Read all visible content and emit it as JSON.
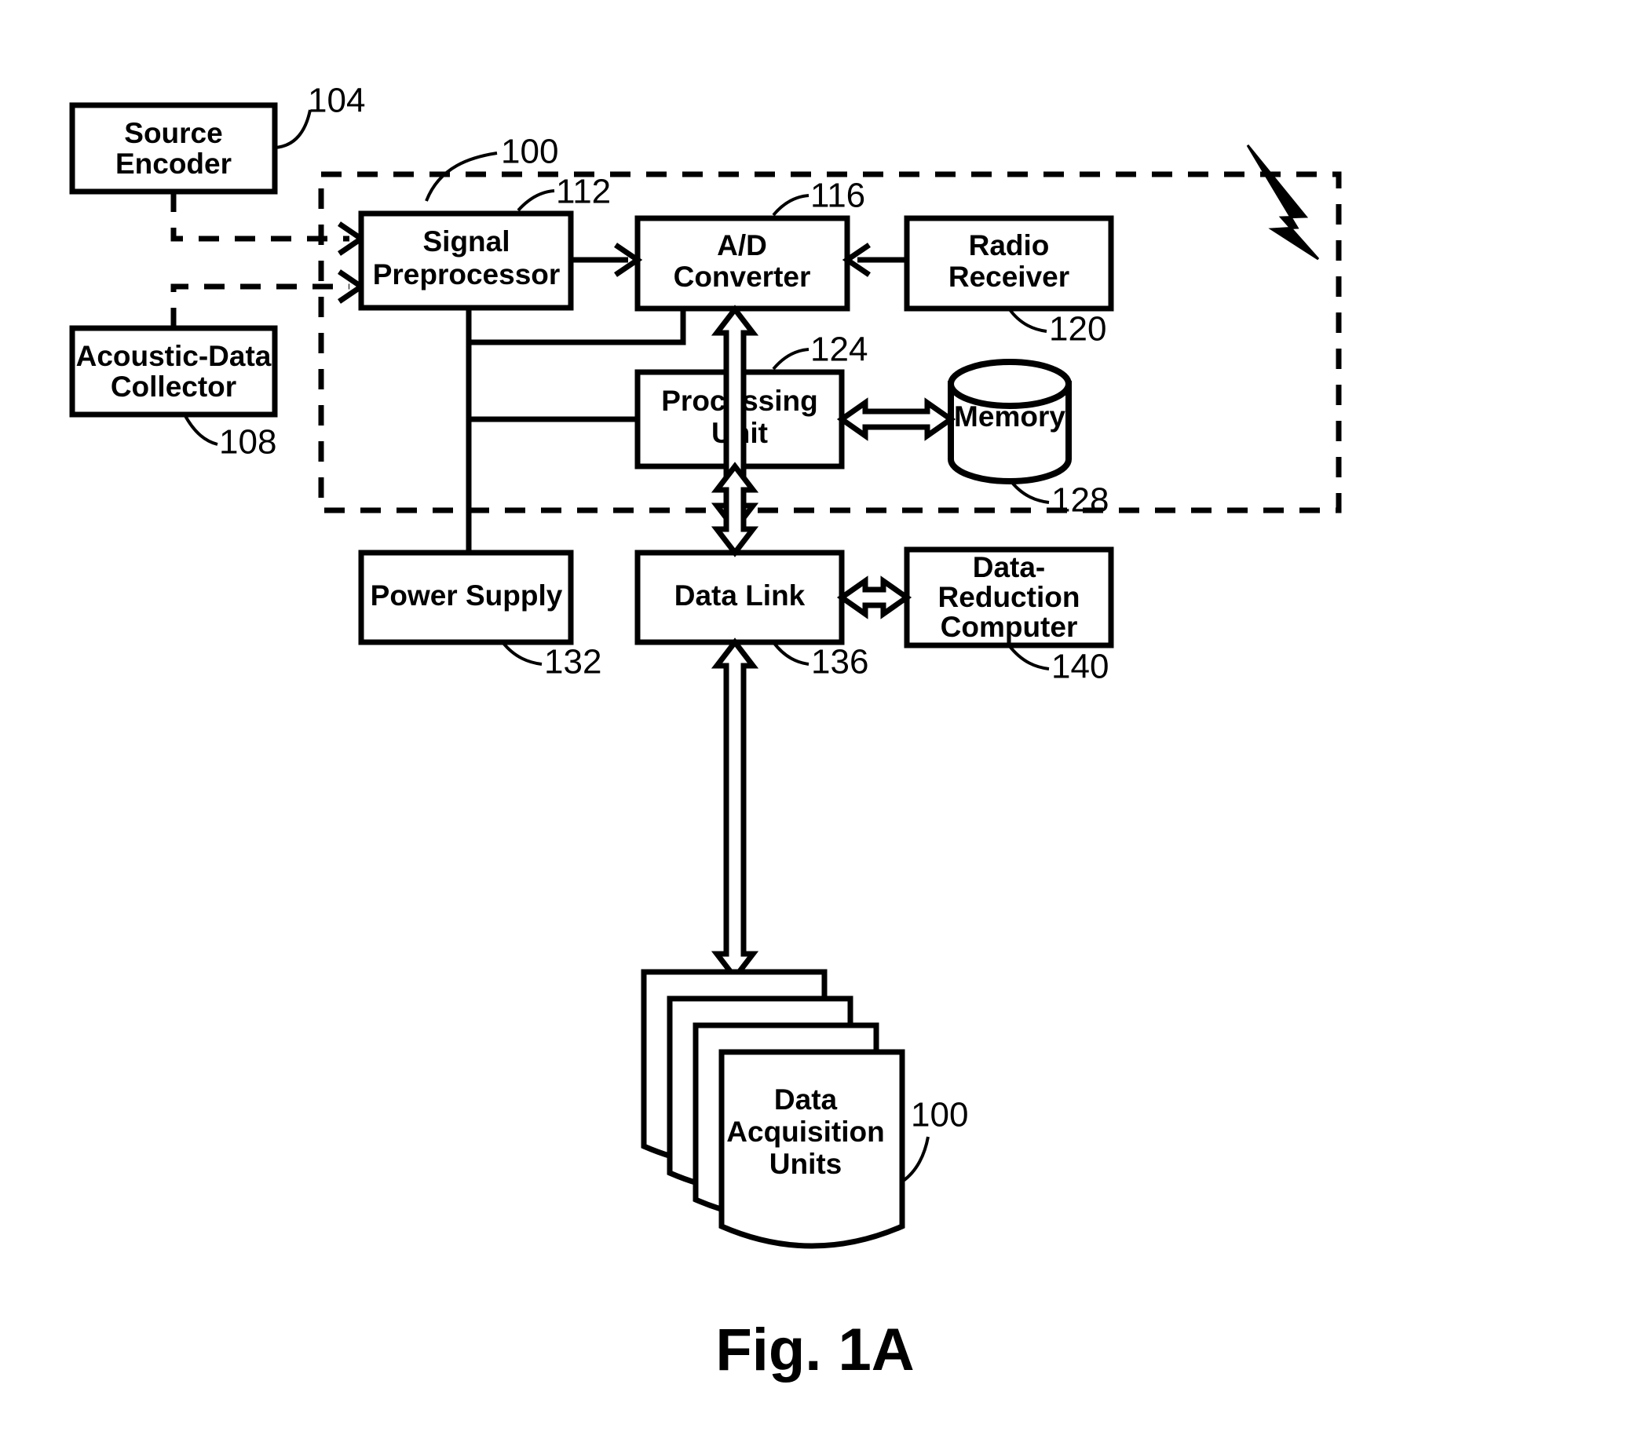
{
  "figure": {
    "caption": "Fig. 1A",
    "boundary_label": "100",
    "blocks": [
      {
        "id": "source-encoder",
        "lines": [
          "Source",
          "Encoder"
        ],
        "ref": "104"
      },
      {
        "id": "acoustic-data-collector",
        "lines": [
          "Acoustic-Data",
          "Collector"
        ],
        "ref": "108"
      },
      {
        "id": "signal-preprocessor",
        "lines": [
          "Signal",
          "Preprocessor"
        ],
        "ref": "112"
      },
      {
        "id": "ad-converter",
        "lines": [
          "A/D",
          "Converter"
        ],
        "ref": "116"
      },
      {
        "id": "radio-receiver",
        "lines": [
          "Radio",
          "Receiver"
        ],
        "ref": "120"
      },
      {
        "id": "processing-unit",
        "lines": [
          "Processing",
          "Unit"
        ],
        "ref": "124"
      },
      {
        "id": "memory",
        "lines": [
          "Memory"
        ],
        "ref": "128"
      },
      {
        "id": "power-supply",
        "lines": [
          "Power Supply"
        ],
        "ref": "132"
      },
      {
        "id": "data-link",
        "lines": [
          "Data Link"
        ],
        "ref": "136"
      },
      {
        "id": "data-reduction-computer",
        "lines": [
          "Data-",
          "Reduction",
          "Computer"
        ],
        "ref": "140"
      },
      {
        "id": "data-acquisition-units",
        "lines": [
          "Data",
          "Acquisition",
          "Units"
        ],
        "ref": "100"
      }
    ],
    "labels": {
      "source_encoder_l1": "Source",
      "source_encoder_l2": "Encoder",
      "acoustic_collector_l1": "Acoustic-Data",
      "acoustic_collector_l2": "Collector",
      "signal_preprocessor_l1": "Signal",
      "signal_preprocessor_l2": "Preprocessor",
      "ad_converter_l1": "A/D",
      "ad_converter_l2": "Converter",
      "radio_receiver_l1": "Radio",
      "radio_receiver_l2": "Receiver",
      "processing_unit_l1": "Processing",
      "processing_unit_l2": "Unit",
      "memory": "Memory",
      "power_supply": "Power Supply",
      "data_link": "Data Link",
      "data_reduction_l1": "Data-",
      "data_reduction_l2": "Reduction",
      "data_reduction_l3": "Computer",
      "dau_l1": "Data",
      "dau_l2": "Acquisition",
      "dau_l3": "Units"
    },
    "refs": {
      "r100_top": "100",
      "r104": "104",
      "r108": "108",
      "r112": "112",
      "r116": "116",
      "r120": "120",
      "r124": "124",
      "r128": "128",
      "r132": "132",
      "r136": "136",
      "r140": "140",
      "r100_dau": "100"
    },
    "colors": {
      "ink": "#000000",
      "paper": "#ffffff"
    }
  }
}
